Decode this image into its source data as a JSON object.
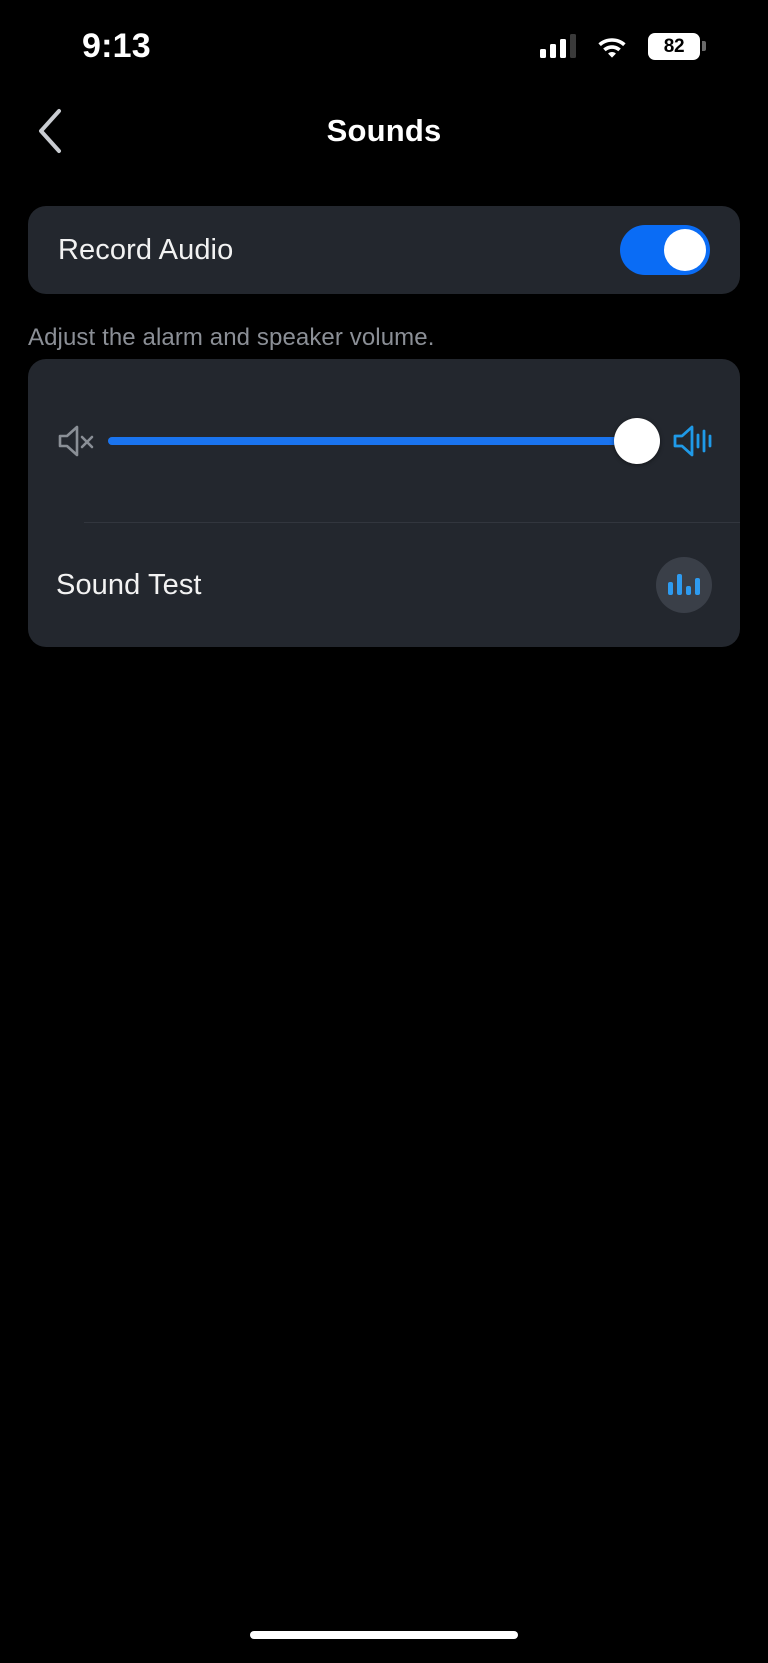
{
  "status_bar": {
    "time": "9:13",
    "signal_icon": "cellular-signal-icon",
    "signal_bars_filled": 3,
    "signal_bars_total": 4,
    "wifi_icon": "wifi-icon",
    "battery_level": "82",
    "battery_icon": "battery-icon"
  },
  "nav": {
    "back_icon": "chevron-left-icon",
    "title": "Sounds"
  },
  "settings": {
    "record_audio": {
      "label": "Record Audio",
      "toggle_state": "on",
      "toggle_color": "#0a6cf5"
    },
    "volume_note": "Adjust the alarm and speaker volume.",
    "volume": {
      "mute_icon": "speaker-mute-icon",
      "loud_icon": "speaker-loud-icon",
      "value": 100,
      "min": 0,
      "max": 100,
      "fill_color": "#1a74ef",
      "track_color": "#3c4049"
    },
    "sound_test": {
      "label": "Sound Test",
      "button_icon": "audio-waveform-icon",
      "accent_color": "#2e9bf0"
    }
  },
  "system": {
    "home_indicator": "home-indicator"
  }
}
